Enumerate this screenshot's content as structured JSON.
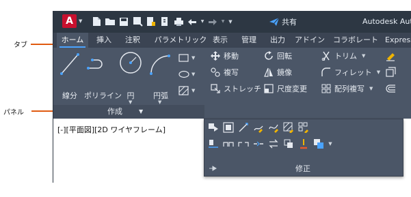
{
  "callouts": {
    "tab": "タブ",
    "panel": "パネル"
  },
  "titlebar": {
    "logo_letter": "A",
    "share_label": "共有",
    "app_title": "Autodesk AutoCAD"
  },
  "tabs": [
    "ホーム",
    "挿入",
    "注釈",
    "パラメトリック",
    "表示",
    "管理",
    "出力",
    "アドイン",
    "コラボレート",
    "Express"
  ],
  "draw_panel": {
    "title": "作成",
    "tools": {
      "line": "線分",
      "polyline": "ポリライン",
      "circle": "円",
      "arc": "円弧"
    }
  },
  "modify_panel": {
    "title": "修正",
    "tools": {
      "move": "移動",
      "rotate": "回転",
      "trim": "トリム",
      "copy": "複写",
      "mirror": "鏡像",
      "fillet": "フィレット",
      "stretch": "ストレッチ",
      "scale": "尺度変更",
      "array": "配列複写"
    }
  },
  "viewport": {
    "label": "[-][平面図][2D ワイヤフレーム]"
  },
  "colors": {
    "accent": "#4aa3ff",
    "callout_line": "#e05a10",
    "titlebar": "#2d3743",
    "ribbon": "#4b5667",
    "logo": "#c8102e"
  }
}
